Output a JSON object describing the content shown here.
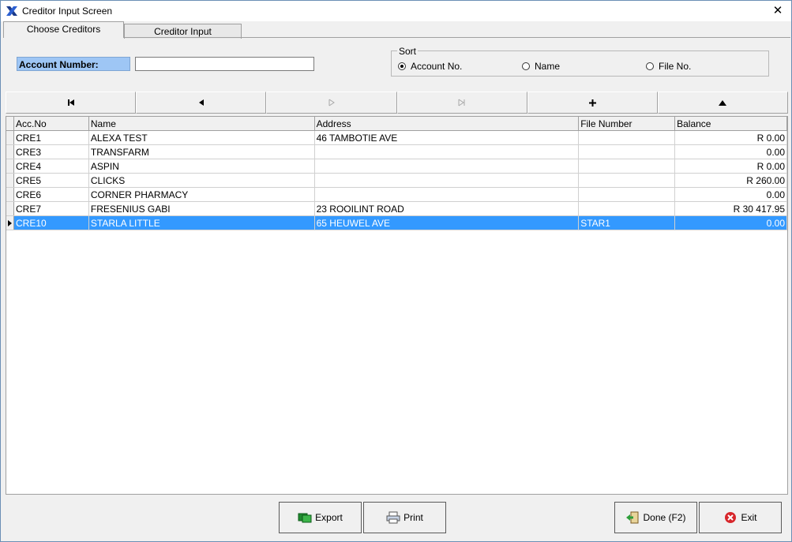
{
  "window": {
    "title": "Creditor Input Screen",
    "close_symbol": "✕"
  },
  "tabs": [
    {
      "label": "Choose Creditors",
      "active": true
    },
    {
      "label": "Creditor Input",
      "active": false
    }
  ],
  "account": {
    "label": "Account Number:",
    "value": ""
  },
  "sort": {
    "legend": "Sort",
    "options": [
      {
        "label": "Account No.",
        "checked": true
      },
      {
        "label": "Name",
        "checked": false
      },
      {
        "label": "File No.",
        "checked": false
      }
    ]
  },
  "navigator": [
    {
      "icon": "first-record-icon",
      "glyph": "⏮",
      "enabled": true
    },
    {
      "icon": "prior-record-icon",
      "glyph": "◀",
      "enabled": true
    },
    {
      "icon": "next-record-icon",
      "glyph": "▷",
      "enabled": false
    },
    {
      "icon": "last-record-icon",
      "glyph": "⊳",
      "enabled": false
    },
    {
      "icon": "insert-record-icon",
      "glyph": "+",
      "enabled": true
    },
    {
      "icon": "delete-record-icon",
      "glyph": "▲",
      "enabled": true
    }
  ],
  "grid": {
    "columns": [
      "Acc.No",
      "Name",
      "Address",
      "File Number",
      "Balance"
    ],
    "rows": [
      {
        "acc": "CRE1",
        "name": "ALEXA TEST",
        "address": "46 TAMBOTIE AVE",
        "file": "",
        "balance": "R 0.00"
      },
      {
        "acc": "CRE3",
        "name": "TRANSFARM",
        "address": "",
        "file": "",
        "balance": "0.00"
      },
      {
        "acc": "CRE4",
        "name": "ASPIN",
        "address": "",
        "file": "",
        "balance": "R 0.00"
      },
      {
        "acc": "CRE5",
        "name": "CLICKS",
        "address": "",
        "file": "",
        "balance": "R 260.00"
      },
      {
        "acc": "CRE6",
        "name": "CORNER PHARMACY",
        "address": "",
        "file": "",
        "balance": "0.00"
      },
      {
        "acc": "CRE7",
        "name": "FRESENIUS GABI",
        "address": "23 ROOILINT ROAD",
        "file": "",
        "balance": "R 30 417.95"
      },
      {
        "acc": "CRE10",
        "name": "STARLA LITTLE",
        "address": "65 HEUWEL AVE",
        "file": "STAR1",
        "balance": "0.00",
        "selected": true
      }
    ]
  },
  "buttons": {
    "export": "Export",
    "print": "Print",
    "done": "Done (F2)",
    "exit": "Exit"
  },
  "colors": {
    "selection": "#3399ff",
    "label_bg": "#9ec6f5"
  }
}
